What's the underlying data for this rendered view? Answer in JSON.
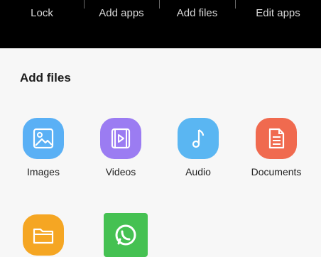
{
  "top_tabs": [
    {
      "label": "Lock"
    },
    {
      "label": "Add apps"
    },
    {
      "label": "Add files"
    },
    {
      "label": "Edit apps"
    }
  ],
  "sheet": {
    "title": "Add files",
    "items": [
      {
        "label": "Images",
        "icon": "image-icon",
        "color": "#5ab0f5"
      },
      {
        "label": "Videos",
        "icon": "video-icon",
        "color": "#9b7cf2"
      },
      {
        "label": "Audio",
        "icon": "music-note-icon",
        "color": "#5ab6f2"
      },
      {
        "label": "Documents",
        "icon": "document-icon",
        "color": "#f06a4f"
      },
      {
        "label": "",
        "icon": "folder-icon",
        "color": "#f5a623"
      },
      {
        "label": "",
        "icon": "whatsapp-icon",
        "color": "#45c152"
      }
    ]
  },
  "colors": {
    "top_bar": "#000000",
    "sheet_bg": "#f7f7f7"
  }
}
